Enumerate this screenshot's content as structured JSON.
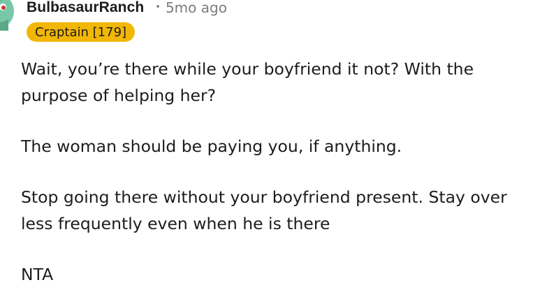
{
  "comment": {
    "author": "BulbasaurRanch",
    "separator": "•",
    "timestamp": "5mo ago",
    "flair": "Craptain [179]",
    "paragraphs": [
      "Wait, you’re there while your boyfriend it not? With the purpose of helping her?",
      "The woman should be paying you, if anything.",
      "Stop going there without your boyfriend present. Stay over less frequently even when he is there",
      "NTA"
    ]
  },
  "colors": {
    "flair_background": "#f2b705",
    "meta_text": "#7c7c7c",
    "body_text": "#1c1c1c",
    "avatar_green": "#78c8a8"
  },
  "icons": {
    "avatar": "bulbasaur-avatar-icon"
  }
}
